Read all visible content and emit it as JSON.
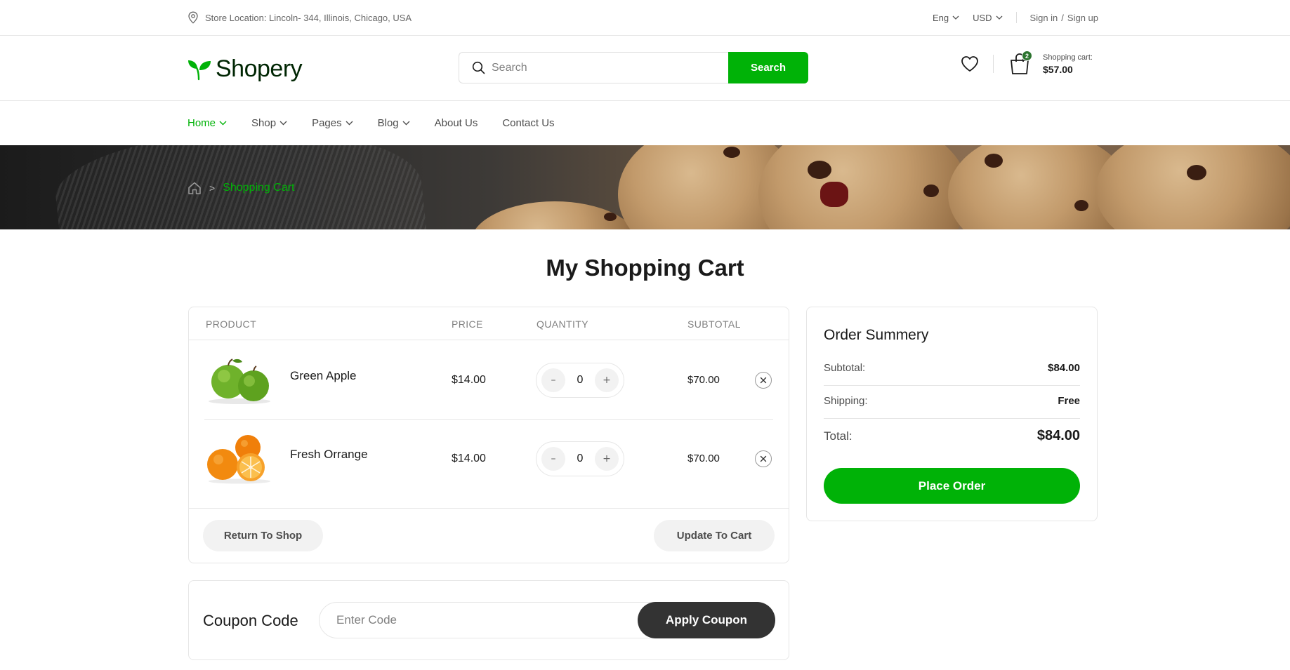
{
  "topbar": {
    "store_location": "Store Location: Lincoln- 344, Illinois, Chicago, USA",
    "language": "Eng",
    "currency": "USD",
    "sign_in": "Sign in",
    "auth_separator": "/",
    "sign_up": "Sign up"
  },
  "header": {
    "logo": "Shopery",
    "search_placeholder": "Search",
    "search_button": "Search",
    "cart_count": "2",
    "cart_label": "Shopping cart:",
    "cart_total": "$57.00"
  },
  "nav": {
    "items": [
      {
        "label": "Home",
        "dropdown": true,
        "active": true
      },
      {
        "label": "Shop",
        "dropdown": true
      },
      {
        "label": "Pages",
        "dropdown": true
      },
      {
        "label": "Blog",
        "dropdown": true
      },
      {
        "label": "About Us",
        "dropdown": false
      },
      {
        "label": "Contact Us",
        "dropdown": false
      }
    ]
  },
  "breadcrumb": {
    "separator": ">",
    "current": "Shopping Cart"
  },
  "page_title": "My Shopping Cart",
  "cart": {
    "headers": {
      "product": "PRODUCT",
      "price": "PRICE",
      "quantity": "QUANTITY",
      "subtotal": "SUBTOTAL"
    },
    "items": [
      {
        "name": "Green Apple",
        "price": "$14.00",
        "quantity": "0",
        "subtotal": "$70.00"
      },
      {
        "name": "Fresh Orrange",
        "price": "$14.00",
        "quantity": "0",
        "subtotal": "$70.00"
      }
    ],
    "qty_minus": "–",
    "qty_plus": "+",
    "return_button": "Return To Shop",
    "update_button": "Update To Cart"
  },
  "coupon": {
    "label": "Coupon Code",
    "placeholder": "Enter Code",
    "button": "Apply Coupon"
  },
  "summary": {
    "title": "Order Summery",
    "subtotal_label": "Subtotal:",
    "subtotal_value": "$84.00",
    "shipping_label": "Shipping:",
    "shipping_value": "Free",
    "total_label": "Total:",
    "total_value": "$84.00",
    "button": "Place Order"
  },
  "colors": {
    "primary": "#00b207",
    "dark": "#333333",
    "badge": "#2c742f"
  },
  "icons": [
    "location-pin-icon",
    "chevron-down-icon",
    "leaf-logo-icon",
    "search-icon",
    "heart-icon",
    "shopping-bag-icon",
    "home-icon",
    "close-icon"
  ]
}
